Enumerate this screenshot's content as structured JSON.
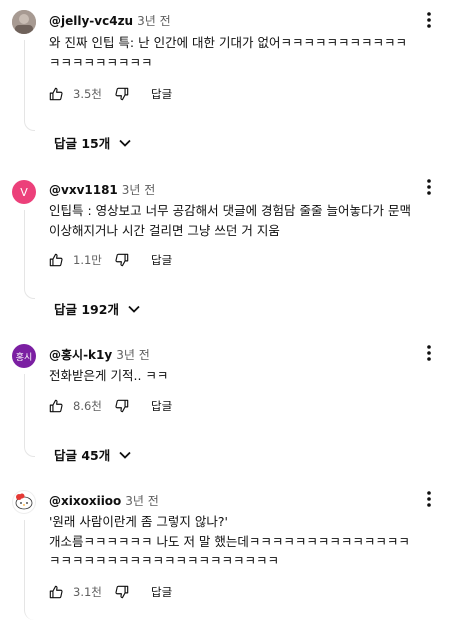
{
  "comments": [
    {
      "author": "@jelly-vc4zu",
      "time": "3년 전",
      "lines": [
        "와 진짜 인팁 특: 난 인간에 대한 기대가 없어ㅋㅋㅋㅋㅋㅋㅋㅋㅋㅋㅋ",
        "ㅋㅋㅋㅋㅋㅋㅋㅋㅋ"
      ],
      "likes": "3.5천",
      "reply_label": "답글",
      "replies_label": "답글 15개",
      "avatar_color": "#9e8f86"
    },
    {
      "author": "@vxv1181",
      "time": "3년 전",
      "avatar_letter": "V",
      "lines": [
        "인팁특 : 영상보고 너무 공감해서 댓글에 경험담 줄줄 늘어놓다가 문맥",
        "이상해지거나 시간 걸리면 그냥 쓰던 거 지움"
      ],
      "likes": "1.1만",
      "reply_label": "답글",
      "replies_label": "답글 192개",
      "avatar_color": "#ec407a"
    },
    {
      "author": "@홍시-k1y",
      "time": "3년 전",
      "avatar_letter": "홍시",
      "lines": [
        "전화받은게 기적.. ㅋㅋ"
      ],
      "likes": "8.6천",
      "reply_label": "답글",
      "replies_label": "답글 45개",
      "avatar_color": "#7b1fa2"
    },
    {
      "author": "@xixoxiioo",
      "time": "3년 전",
      "lines": [
        "'원래 사람이란게 좀 그렇지 않나?'",
        "개소름ㅋㅋㅋㅋㅋㅋ 나도 저 말 했는데ㅋㅋㅋㅋㅋㅋㅋㅋㅋㅋㅋㅋㅋㅋ",
        "ㅋㅋㅋㅋㅋㅋㅋㅋㅋㅋㅋㅋㅋㅋㅋㅋㅋㅋㅋㅋ"
      ],
      "likes": "3.1천",
      "reply_label": "답글",
      "avatar_color": "#ffffff"
    }
  ],
  "icons": {
    "like": "thumb-up-icon",
    "dislike": "thumb-down-icon",
    "menu": "more-vert-icon",
    "expand": "chevron-down-icon"
  }
}
